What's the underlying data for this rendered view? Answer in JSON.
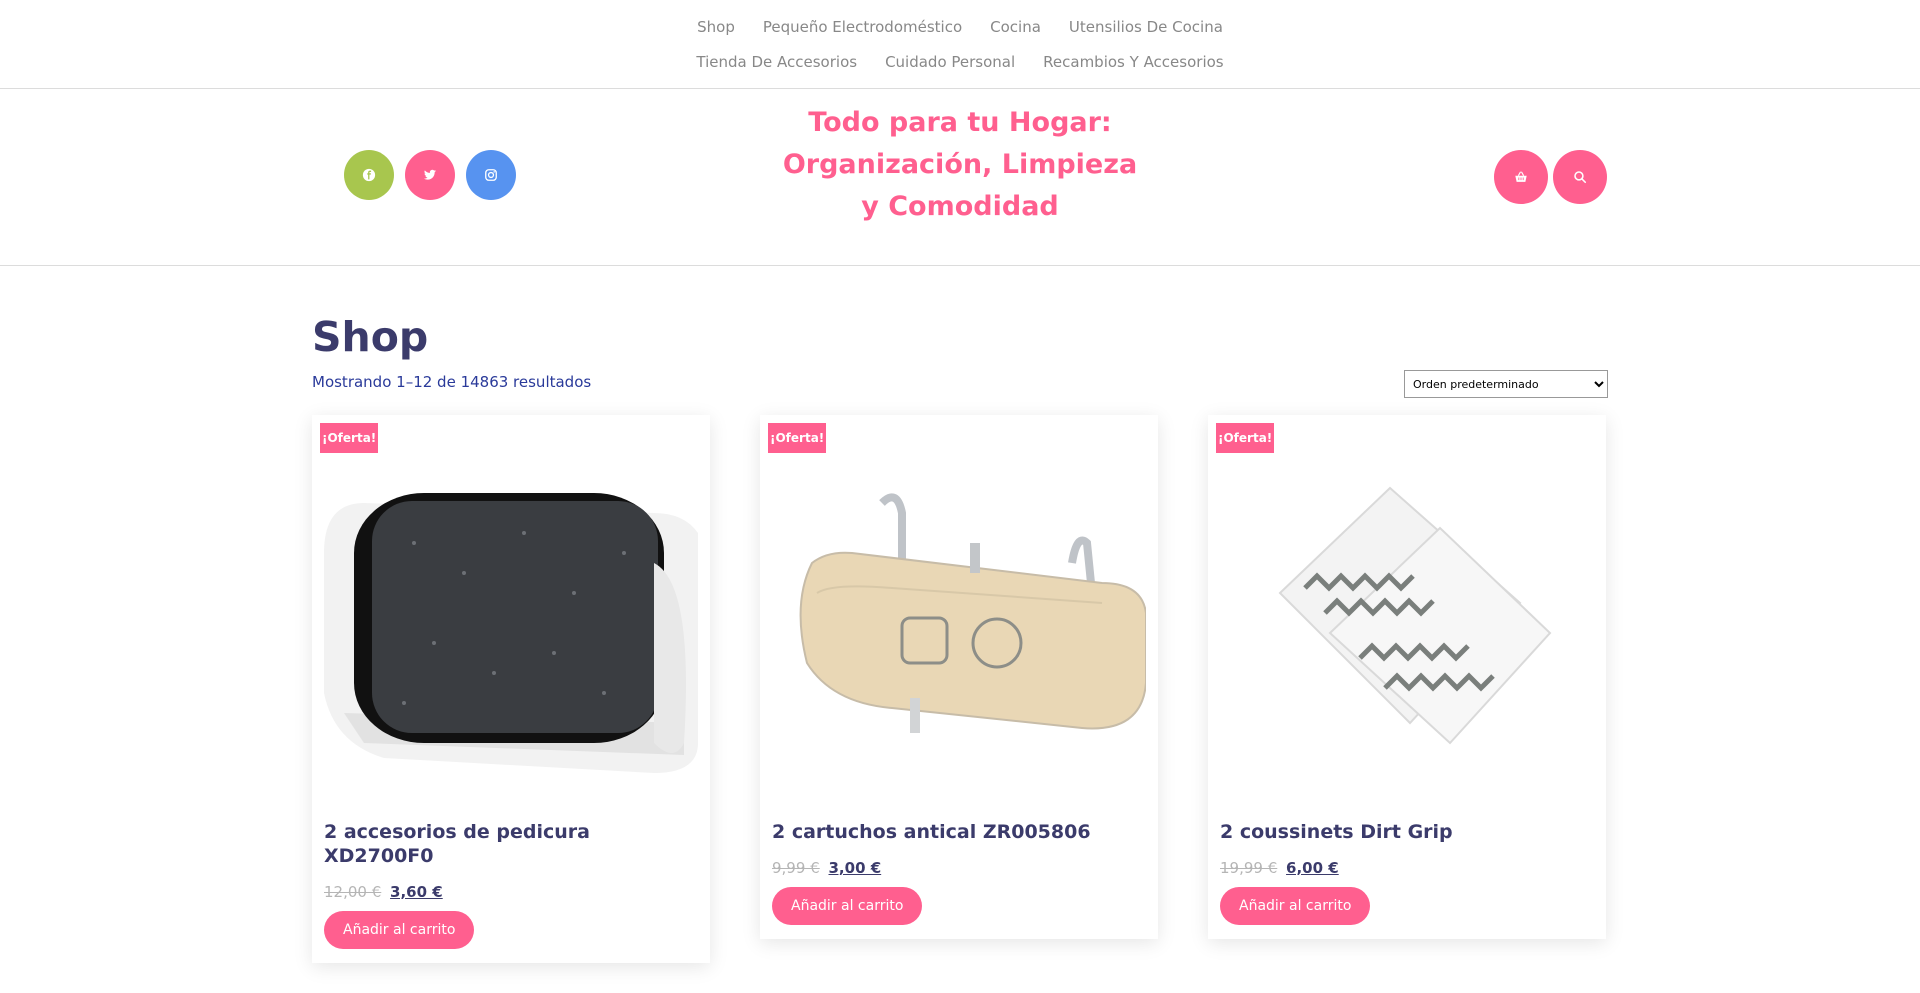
{
  "nav": {
    "row1": [
      "Shop",
      "Pequeño Electrodoméstico",
      "Cocina",
      "Utensilios De Cocina"
    ],
    "row2": [
      "Tienda De Accesorios",
      "Cuidado Personal",
      "Recambios Y Accesorios"
    ]
  },
  "header": {
    "title_lines": [
      "Todo para tu Hogar:",
      "Organización, Limpieza",
      "y Comodidad"
    ],
    "social": [
      {
        "name": "facebook-icon",
        "color": "#a8c64e"
      },
      {
        "name": "twitter-icon",
        "color": "#ff5f8f"
      },
      {
        "name": "instagram-icon",
        "color": "#5793f0"
      }
    ],
    "actions": [
      {
        "name": "cart-icon",
        "color": "#ff5f8f"
      },
      {
        "name": "search-icon",
        "color": "#ff5f8f"
      }
    ]
  },
  "shop": {
    "title": "Shop",
    "result_count": "Mostrando 1–12 de 14863 resultados",
    "ordering": {
      "selected": "Orden predeterminado"
    }
  },
  "products": [
    {
      "badge": "¡Oferta!",
      "name": "2 accesorios de pedicura XD2700F0",
      "old_price": "12,00 €",
      "price": "3,60 €",
      "button": "Añadir al carrito"
    },
    {
      "badge": "¡Oferta!",
      "name": "2 cartuchos antical ZR005806",
      "old_price": "9,99 €",
      "price": "3,00 €",
      "button": "Añadir al carrito"
    },
    {
      "badge": "¡Oferta!",
      "name": "2 coussinets Dirt Grip",
      "old_price": "19,99 €",
      "price": "6,00 €",
      "button": "Añadir al carrito"
    }
  ],
  "colors": {
    "accent": "#ff5f8f",
    "heading": "#3b3b6b",
    "count": "#2a3a9a"
  }
}
